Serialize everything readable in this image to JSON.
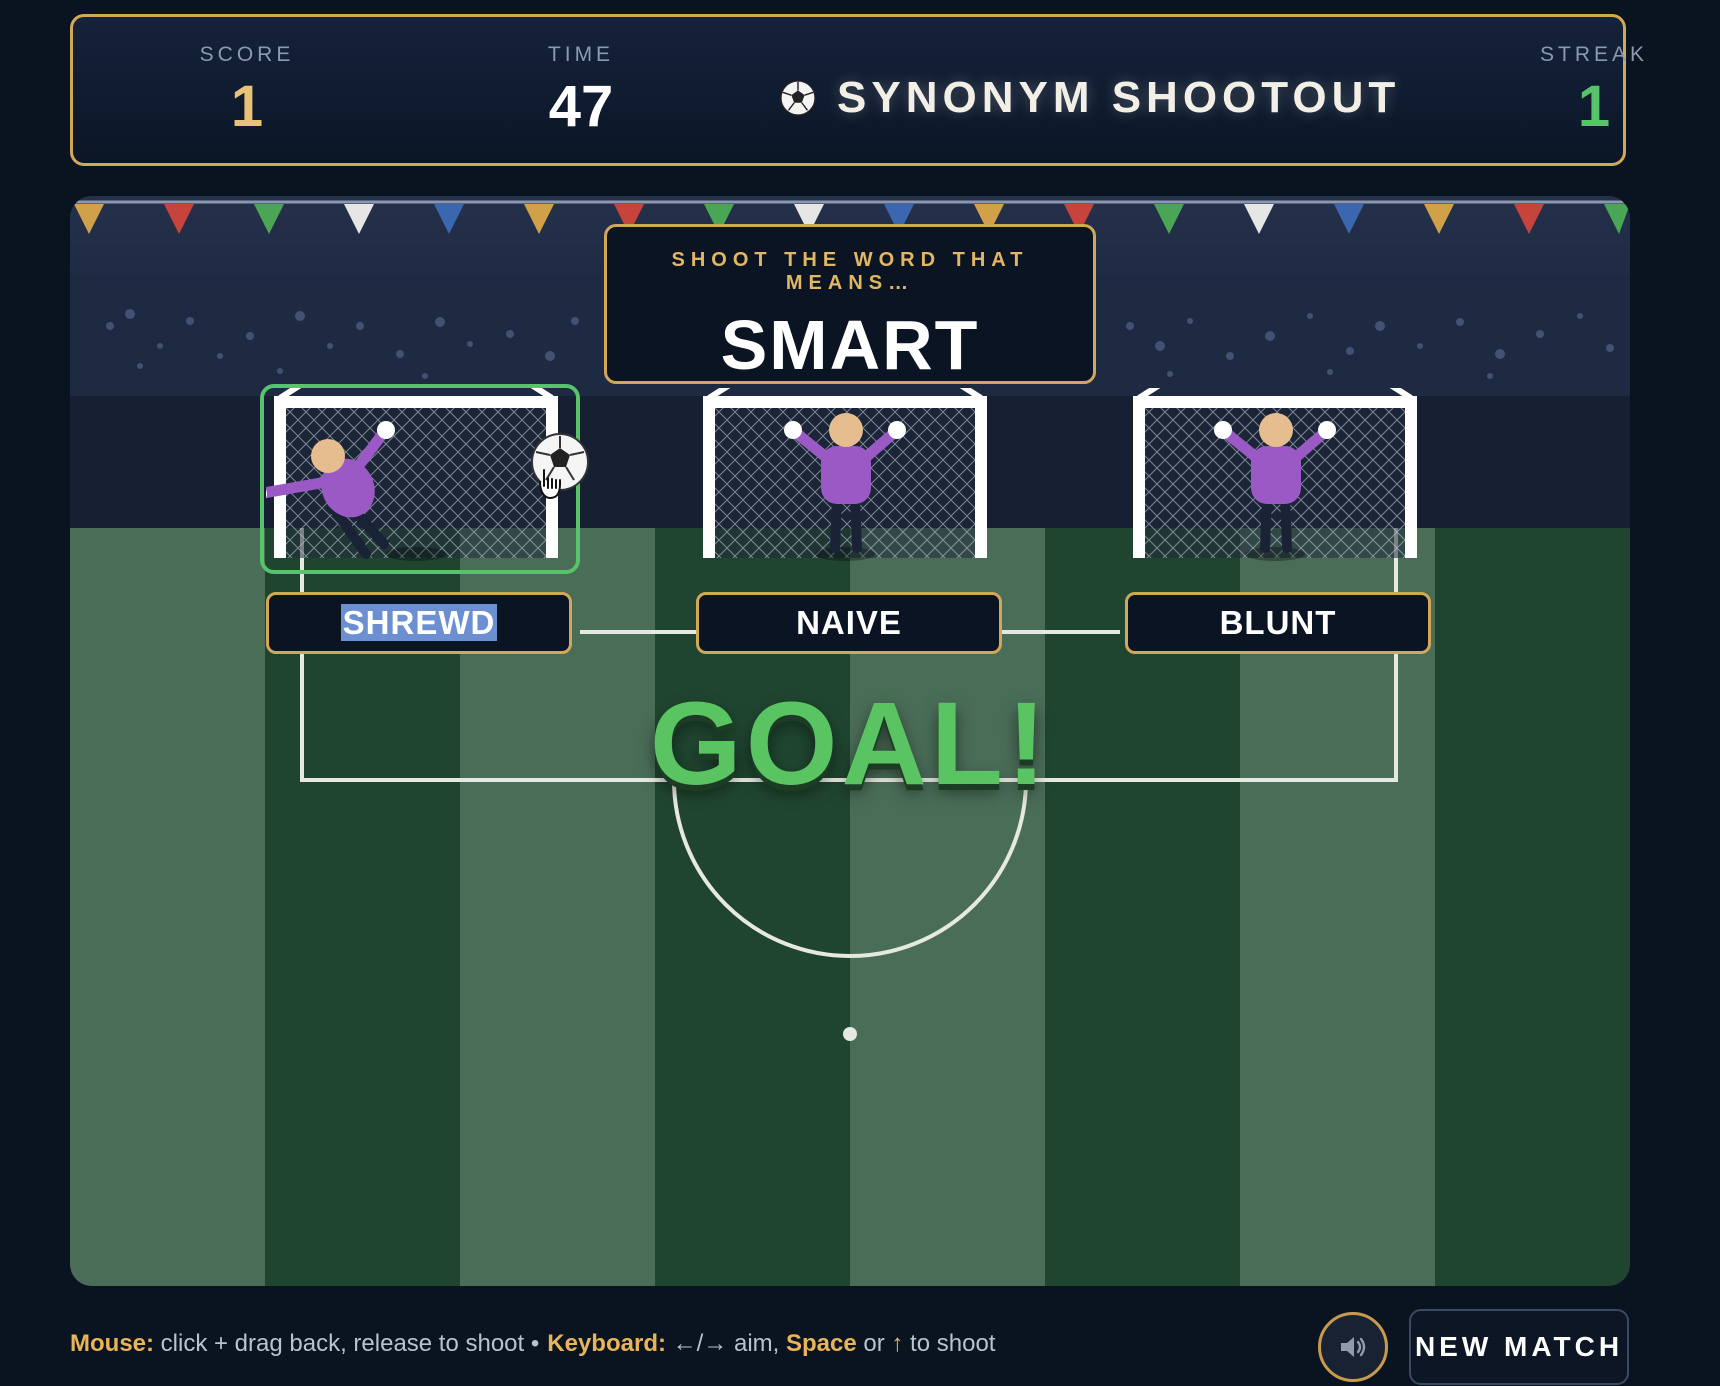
{
  "header": {
    "score_label": "SCORE",
    "score_value": "1",
    "time_label": "TIME",
    "time_value": "47",
    "title": "SYNONYM SHOOTOUT",
    "title_icon": "soccer-ball-icon",
    "streak_label": "STREAK",
    "streak_value": "1"
  },
  "prompt": {
    "label": "SHOOT THE WORD THAT MEANS…",
    "word": "SMART"
  },
  "goals": [
    {
      "word": "SHREWD",
      "state": "scored"
    },
    {
      "word": "NAIVE",
      "state": "idle"
    },
    {
      "word": "BLUNT",
      "state": "idle"
    }
  ],
  "result_text": "GOAL!",
  "footer": {
    "mouse_key": "Mouse:",
    "mouse_text": " click + drag back, release to shoot ",
    "separator": "•",
    "keyboard_key": "Keyboard:",
    "keyboard_text": " ←/→ aim, ",
    "space_key": "Space",
    "or_text": " or ",
    "up_key": "↑",
    "shoot_text": " to shoot",
    "sound_icon": "speaker-icon",
    "new_match_label": "NEW MATCH"
  },
  "colors": {
    "accent_gold": "#d3a758",
    "success_green": "#57c36a",
    "keeper_purple": "#9b59c6",
    "background": "#0a1420"
  }
}
